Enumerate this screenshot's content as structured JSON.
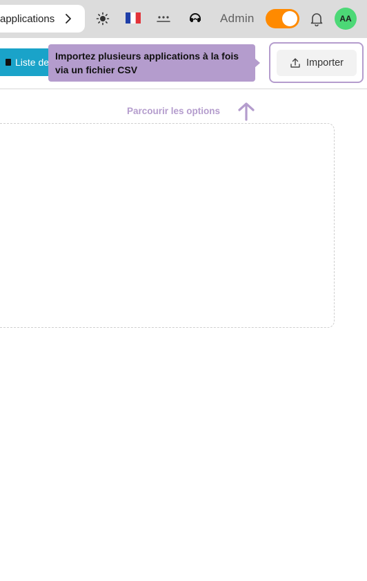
{
  "header": {
    "apps_pill_label": "applications",
    "admin_label": "Admin",
    "admin_toggle_on": true,
    "avatar_initials": "AA",
    "flag": "🇫🇷",
    "colors": {
      "toggle": "#ff8a00",
      "avatar": "#4cd876",
      "topbar": "#dcdcdc"
    }
  },
  "toolbar": {
    "list_button_label": "Liste de",
    "import_button_label": "Importer",
    "tooltip_text": "Importez plusieurs applications à la fois via un fichier CSV",
    "browse_hint": "Parcourir les options",
    "colors": {
      "list_button": "#1aa3c9",
      "tooltip": "#b49ccd"
    }
  },
  "icons": [
    "chevron-right-icon",
    "sun-icon",
    "french-flag-icon",
    "more-dots-icon",
    "support-headset-icon",
    "bell-icon",
    "upload-icon",
    "arrow-up-icon"
  ]
}
